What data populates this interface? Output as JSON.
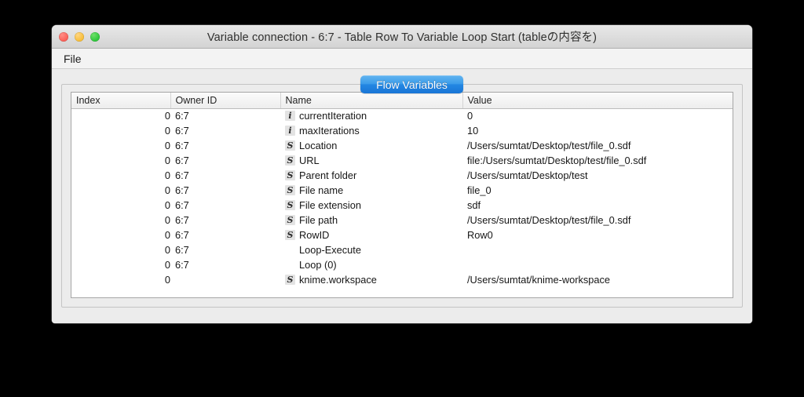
{
  "window": {
    "title": "Variable connection - 6:7 - Table Row To Variable Loop Start (tableの内容を)",
    "traffic_lights": {
      "close": "close-button",
      "minimize": "minimize-button",
      "zoom": "zoom-button"
    },
    "colors": {
      "close": "#fa5e55",
      "minimize": "#f7bd36",
      "zoom": "#2cc63a",
      "tab_accent": "#2387e3",
      "window_bg": "#ececec",
      "table_bg": "#ffffff"
    }
  },
  "menubar": {
    "items": [
      {
        "label": "File"
      }
    ]
  },
  "tabs": [
    {
      "label": "Flow Variables",
      "selected": true
    }
  ],
  "table": {
    "columns": [
      {
        "key": "index",
        "label": "Index"
      },
      {
        "key": "owner",
        "label": "Owner ID"
      },
      {
        "key": "name",
        "label": "Name"
      },
      {
        "key": "value",
        "label": "Value"
      }
    ],
    "rows": [
      {
        "index": "0",
        "owner": "6:7",
        "icon": "i",
        "name": "currentIteration",
        "value": "0"
      },
      {
        "index": "0",
        "owner": "6:7",
        "icon": "i",
        "name": "maxIterations",
        "value": "10"
      },
      {
        "index": "0",
        "owner": "6:7",
        "icon": "S",
        "name": "Location",
        "value": "/Users/sumtat/Desktop/test/file_0.sdf"
      },
      {
        "index": "0",
        "owner": "6:7",
        "icon": "S",
        "name": "URL",
        "value": "file:/Users/sumtat/Desktop/test/file_0.sdf"
      },
      {
        "index": "0",
        "owner": "6:7",
        "icon": "S",
        "name": "Parent folder",
        "value": "/Users/sumtat/Desktop/test"
      },
      {
        "index": "0",
        "owner": "6:7",
        "icon": "S",
        "name": "File name",
        "value": "file_0"
      },
      {
        "index": "0",
        "owner": "6:7",
        "icon": "S",
        "name": "File extension",
        "value": "sdf"
      },
      {
        "index": "0",
        "owner": "6:7",
        "icon": "S",
        "name": "File path",
        "value": "/Users/sumtat/Desktop/test/file_0.sdf"
      },
      {
        "index": "0",
        "owner": "6:7",
        "icon": "S",
        "name": "RowID",
        "value": "Row0"
      },
      {
        "index": "0",
        "owner": "6:7",
        "icon": "",
        "name": "Loop-Execute",
        "value": ""
      },
      {
        "index": "0",
        "owner": "6:7",
        "icon": "",
        "name": "Loop (0)",
        "value": ""
      },
      {
        "index": "0",
        "owner": "",
        "icon": "S",
        "name": "knime.workspace",
        "value": "/Users/sumtat/knime-workspace"
      }
    ]
  }
}
